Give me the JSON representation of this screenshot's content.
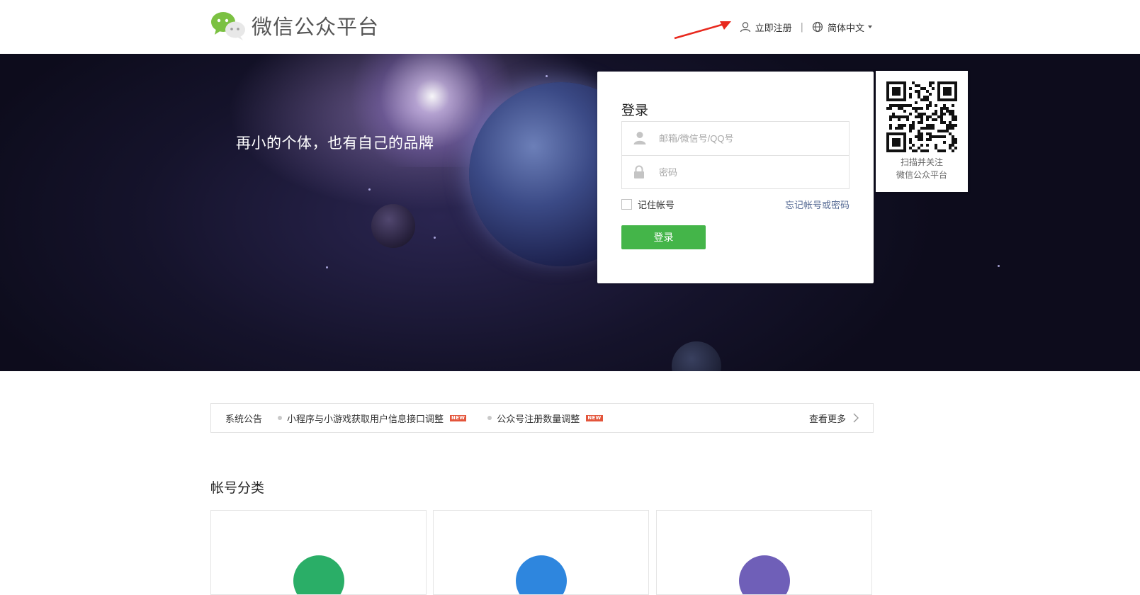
{
  "header": {
    "logo_title": "微信公众平台",
    "register_label": "立即注册",
    "separator": "|",
    "language_label": "简体中文"
  },
  "banner": {
    "slogan": "再小的个体，也有自己的品牌"
  },
  "login": {
    "title": "登录",
    "account_placeholder": "邮箱/微信号/QQ号",
    "password_placeholder": "密码",
    "remember_label": "记住帐号",
    "forgot_label": "忘记帐号或密码",
    "submit_label": "登录"
  },
  "qr": {
    "caption_line1": "扫描并关注",
    "caption_line2": "微信公众平台"
  },
  "notice": {
    "label": "系统公告",
    "items": [
      {
        "text": "小程序与小游戏获取用户信息接口调整",
        "badge": "NEW"
      },
      {
        "text": "公众号注册数量调整",
        "badge": "NEW"
      }
    ],
    "more_label": "查看更多"
  },
  "accounts": {
    "title": "帐号分类",
    "cards": [
      {
        "color": "#2aae67"
      },
      {
        "color": "#2e86de"
      },
      {
        "color": "#6f5fb8"
      }
    ]
  },
  "colors": {
    "brand_green": "#44b549",
    "link_blue": "#576b95",
    "annotation_red": "#e8291e"
  }
}
